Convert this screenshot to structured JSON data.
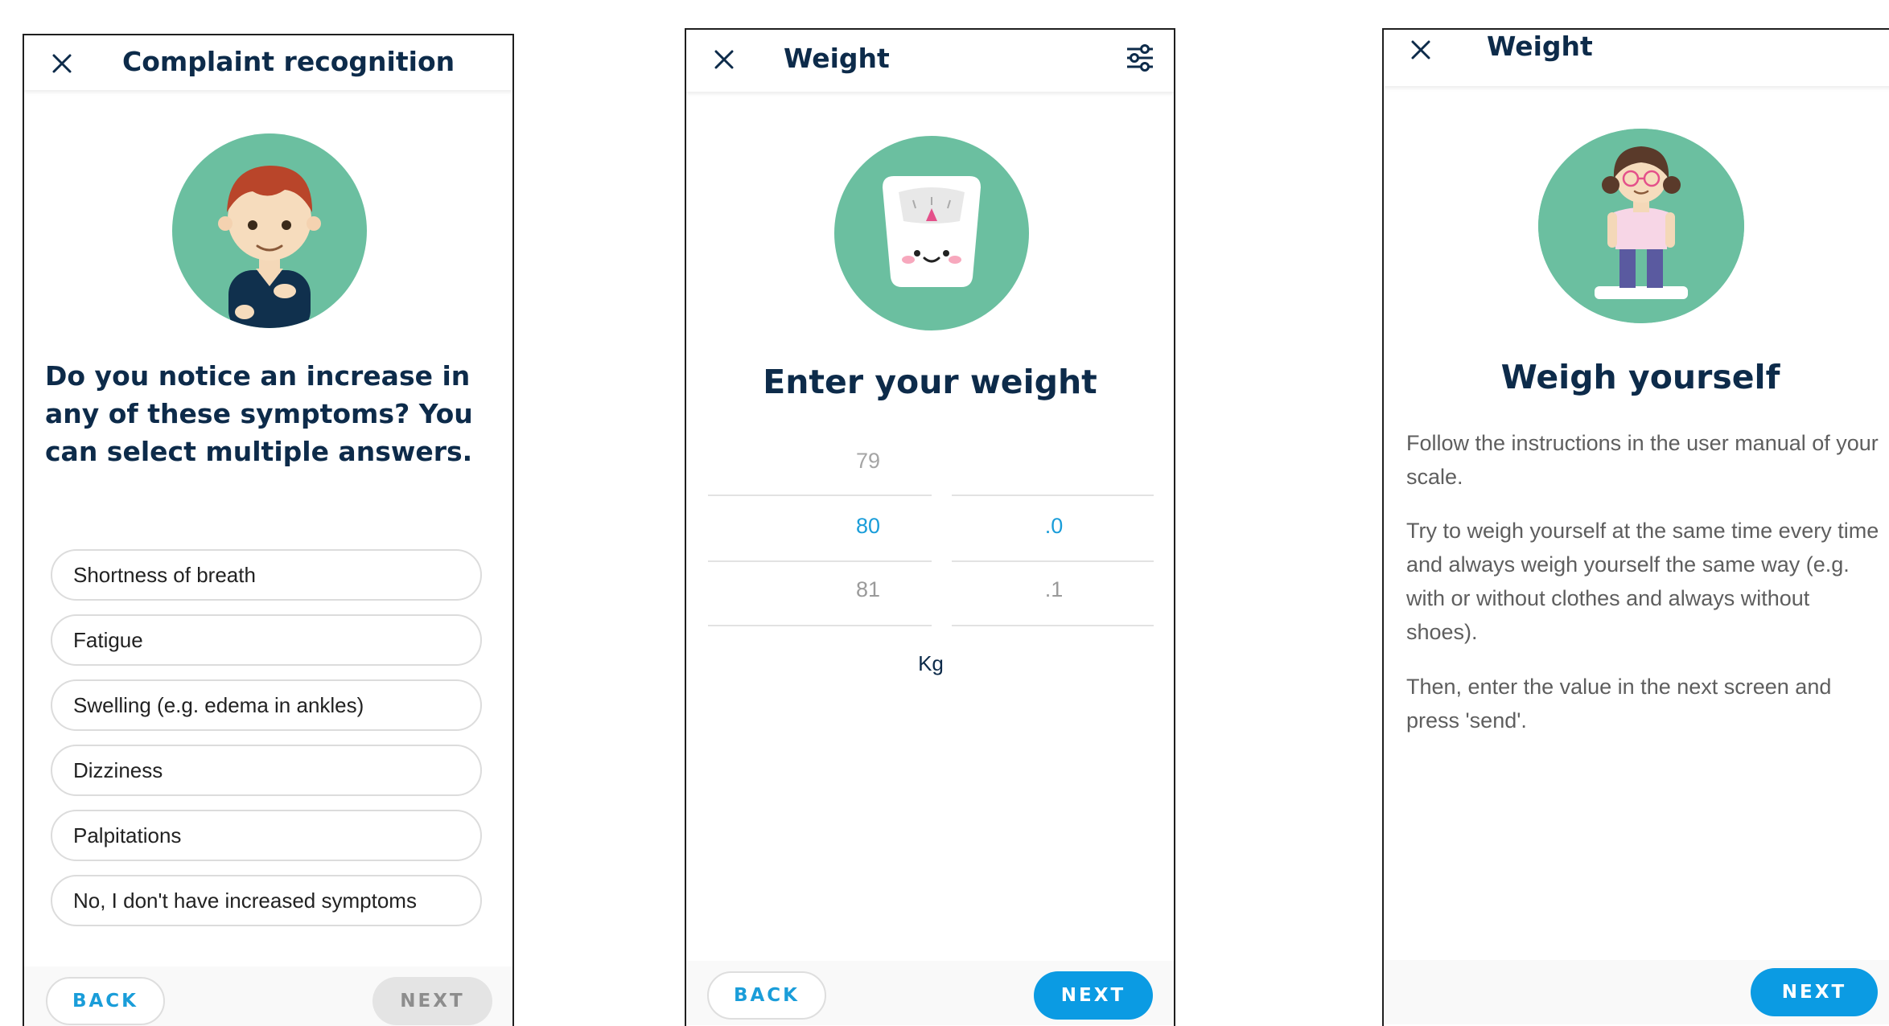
{
  "screen1": {
    "title": "Complaint recognition",
    "question": "Do you notice an increase in any of these symptoms? You can select multiple answers.",
    "options": [
      "Shortness of breath",
      "Fatigue",
      "Swelling (e.g. edema in ankles)",
      "Dizziness",
      "Palpitations",
      "No, I don't have increased symptoms"
    ],
    "back_label": "BACK",
    "next_label": "NEXT"
  },
  "screen2": {
    "title": "Weight",
    "heading": "Enter your weight",
    "picker": {
      "whole": [
        "79",
        "80",
        "81"
      ],
      "decimal": [
        "",
        ".0",
        ".1"
      ],
      "selected_whole": "80",
      "selected_decimal": ".0"
    },
    "unit": "Kg",
    "back_label": "BACK",
    "next_label": "NEXT"
  },
  "screen3": {
    "title": "Weight",
    "heading": "Weigh yourself",
    "paragraphs": [
      "Follow the instructions in the user manual of your scale.",
      "Try to weigh yourself at the same time every time and always weigh yourself the same way (e.g. with or without clothes and always without shoes).",
      "Then, enter the value in the next screen and press 'send'."
    ],
    "next_label": "NEXT"
  },
  "colors": {
    "accent": "#0b9be3",
    "avatar_bg": "#6bbfa0",
    "title": "#0d2b4a",
    "picker_selected": "#1a9dd9"
  }
}
